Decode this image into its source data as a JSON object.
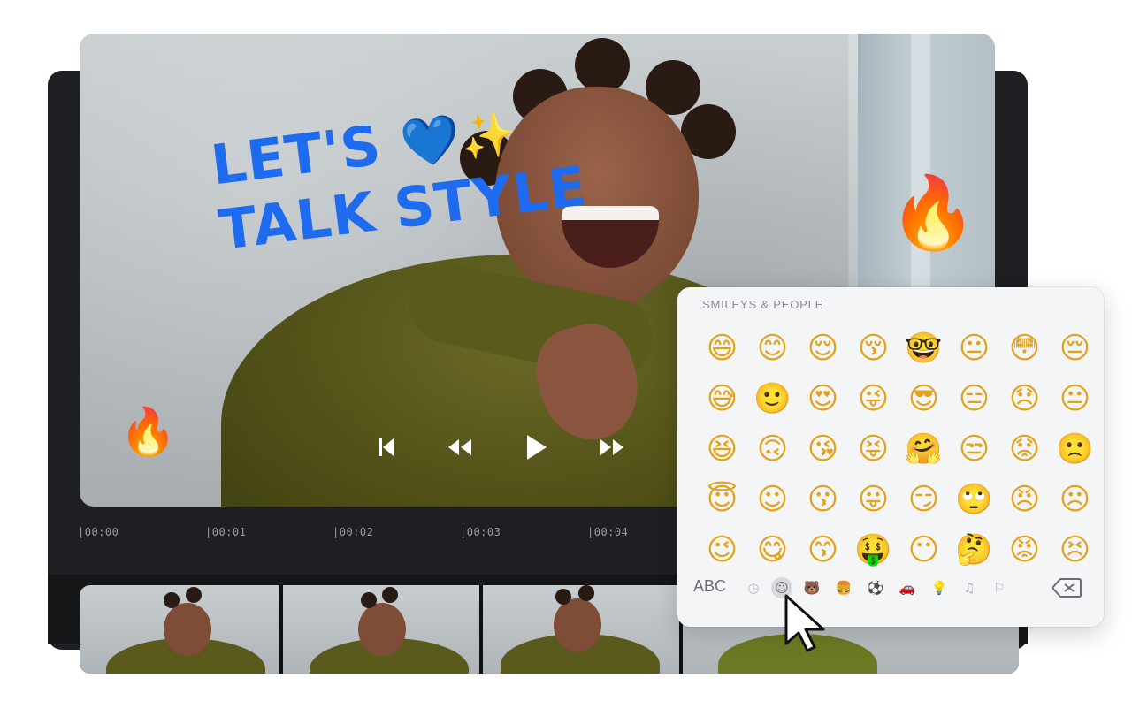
{
  "video": {
    "overlay_text": [
      "LET'S",
      "TALK STYLE"
    ],
    "overlay_emoji": [
      "💙",
      "✨"
    ],
    "stickers": [
      "🔥",
      "🔥"
    ]
  },
  "playback": {
    "icons": [
      "skip-back-icon",
      "rewind-icon",
      "play-icon",
      "fast-forward-icon"
    ]
  },
  "timeline": {
    "ticks": [
      "|00:00",
      "|00:01",
      "|00:02",
      "|00:03",
      "|00:04"
    ]
  },
  "emoji_keyboard": {
    "heading": "SMILEYS & PEOPLE",
    "rows": [
      [
        "😄",
        "😊",
        "😌",
        "😚",
        "🤓",
        "😐",
        "😳",
        "😔"
      ],
      [
        "😅",
        "🙂",
        "😍",
        "😜",
        "😎",
        "😑",
        "😞",
        "😐"
      ],
      [
        "😆",
        "🙃",
        "😘",
        "😝",
        "🤗",
        "😒",
        "😟",
        "🙁"
      ],
      [
        "😇",
        "☺",
        "😗",
        "😛",
        "😏",
        "🙄",
        "😠",
        "☹"
      ],
      [
        "😉",
        "😋",
        "😙",
        "🤑",
        "😶",
        "🤔",
        "😡",
        "😣"
      ]
    ],
    "abc_label": "ABC",
    "categories": [
      "clock-icon",
      "smiley-icon",
      "animal-icon",
      "food-icon",
      "ball-icon",
      "travel-icon",
      "lightbulb-icon",
      "symbols-icon",
      "flag-icon"
    ],
    "category_glyphs": [
      "◷",
      "☺",
      "🐻",
      "🍔",
      "⚽",
      "🚗",
      "💡",
      "♫",
      "⚐"
    ],
    "active_category": "smiley-icon"
  },
  "colors": {
    "overlay_text": "#1e6bf0",
    "editor_background": "#1e1f22",
    "panel_background": "#f4f5f7"
  }
}
